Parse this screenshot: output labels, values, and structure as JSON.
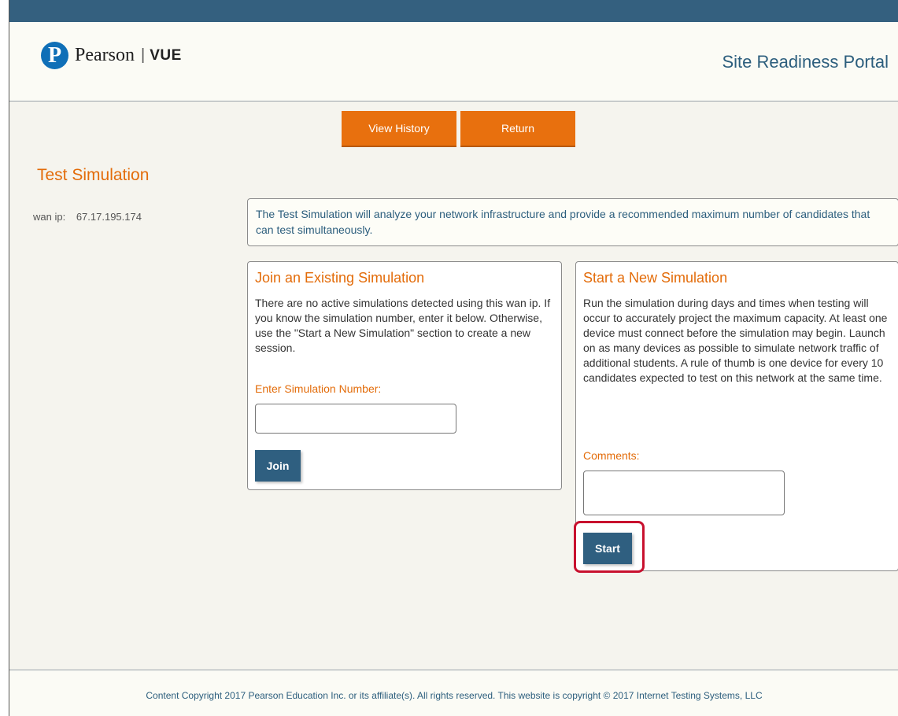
{
  "header": {
    "brand_name": "Pearson",
    "brand_separator": "|",
    "brand_sub": "VUE",
    "logo_letter": "P",
    "portal_title": "Site Readiness Portal"
  },
  "nav": {
    "view_history_label": "View History",
    "return_label": "Return"
  },
  "page": {
    "title": "Test Simulation",
    "wan_label": "wan ip:",
    "wan_value": "67.17.195.174",
    "intro": "The Test Simulation will analyze your network infrastructure and provide a recommended maximum number of candidates that can test simultaneously."
  },
  "join": {
    "title": "Join an Existing Simulation",
    "description": "There are no active simulations detected using this wan ip. If you know the simulation number, enter it below. Otherwise, use the \"Start a New Simulation\" section to create a new session.",
    "field_label": "Enter Simulation Number:",
    "field_value": "",
    "button_label": "Join"
  },
  "start": {
    "title": "Start a New Simulation",
    "description": "Run the simulation during days and times when testing will occur to accurately project the maximum capacity. At least one device must connect before the simulation may begin. Launch on as many devices as possible to simulate network traffic of additional students. A rule of thumb is one device for every 10 candidates expected to test on this network at the same time.",
    "field_label": "Comments:",
    "field_value": "",
    "button_label": "Start"
  },
  "footer": {
    "text": "Content Copyright 2017 Pearson Education Inc. or its affiliate(s). All rights reserved. This website is copyright © 2017 Internet Testing Systems, LLC"
  },
  "colors": {
    "topbar": "#34607f",
    "accent_orange": "#e8700e",
    "heading_orange": "#e36c0a",
    "primary_blue": "#2f5f80",
    "highlight_red": "#c8102e",
    "logo_blue": "#0f6fb7"
  },
  "icons": {
    "logo": "pearson-logo-icon"
  }
}
